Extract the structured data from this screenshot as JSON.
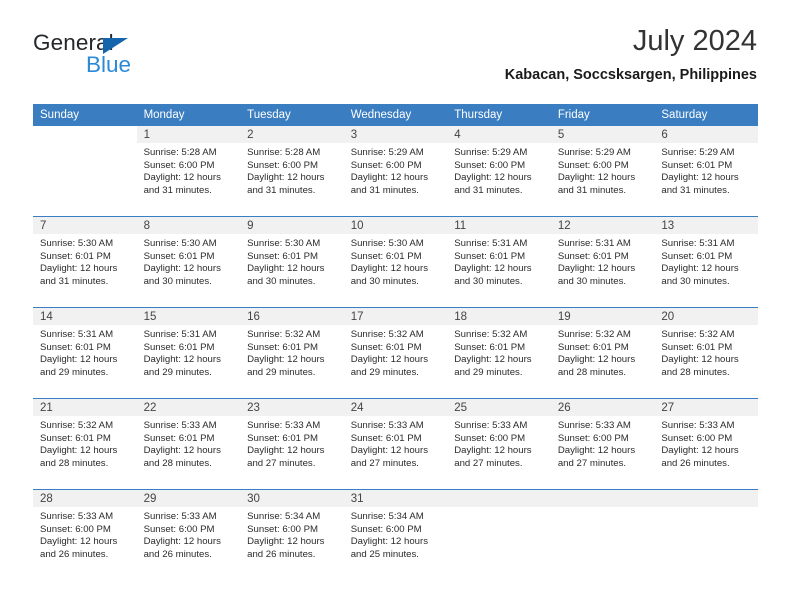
{
  "brand": {
    "name_part1": "General",
    "name_part2": "Blue",
    "accent_color": "#2b8ad8",
    "triangle_color": "#1565ad"
  },
  "header": {
    "title": "July 2024",
    "location": "Kabacan, Soccsksargen, Philippines"
  },
  "calendar": {
    "header_background": "#3a7dc0",
    "weekday_headers": [
      "Sunday",
      "Monday",
      "Tuesday",
      "Wednesday",
      "Thursday",
      "Friday",
      "Saturday"
    ],
    "weeks": [
      [
        {
          "day": "",
          "sunrise": "",
          "sunset": "",
          "daylight_line1": "",
          "daylight_line2": "",
          "blank": true
        },
        {
          "day": "1",
          "sunrise": "Sunrise: 5:28 AM",
          "sunset": "Sunset: 6:00 PM",
          "daylight_line1": "Daylight: 12 hours",
          "daylight_line2": "and 31 minutes."
        },
        {
          "day": "2",
          "sunrise": "Sunrise: 5:28 AM",
          "sunset": "Sunset: 6:00 PM",
          "daylight_line1": "Daylight: 12 hours",
          "daylight_line2": "and 31 minutes."
        },
        {
          "day": "3",
          "sunrise": "Sunrise: 5:29 AM",
          "sunset": "Sunset: 6:00 PM",
          "daylight_line1": "Daylight: 12 hours",
          "daylight_line2": "and 31 minutes."
        },
        {
          "day": "4",
          "sunrise": "Sunrise: 5:29 AM",
          "sunset": "Sunset: 6:00 PM",
          "daylight_line1": "Daylight: 12 hours",
          "daylight_line2": "and 31 minutes."
        },
        {
          "day": "5",
          "sunrise": "Sunrise: 5:29 AM",
          "sunset": "Sunset: 6:00 PM",
          "daylight_line1": "Daylight: 12 hours",
          "daylight_line2": "and 31 minutes."
        },
        {
          "day": "6",
          "sunrise": "Sunrise: 5:29 AM",
          "sunset": "Sunset: 6:01 PM",
          "daylight_line1": "Daylight: 12 hours",
          "daylight_line2": "and 31 minutes."
        }
      ],
      [
        {
          "day": "7",
          "sunrise": "Sunrise: 5:30 AM",
          "sunset": "Sunset: 6:01 PM",
          "daylight_line1": "Daylight: 12 hours",
          "daylight_line2": "and 31 minutes."
        },
        {
          "day": "8",
          "sunrise": "Sunrise: 5:30 AM",
          "sunset": "Sunset: 6:01 PM",
          "daylight_line1": "Daylight: 12 hours",
          "daylight_line2": "and 30 minutes."
        },
        {
          "day": "9",
          "sunrise": "Sunrise: 5:30 AM",
          "sunset": "Sunset: 6:01 PM",
          "daylight_line1": "Daylight: 12 hours",
          "daylight_line2": "and 30 minutes."
        },
        {
          "day": "10",
          "sunrise": "Sunrise: 5:30 AM",
          "sunset": "Sunset: 6:01 PM",
          "daylight_line1": "Daylight: 12 hours",
          "daylight_line2": "and 30 minutes."
        },
        {
          "day": "11",
          "sunrise": "Sunrise: 5:31 AM",
          "sunset": "Sunset: 6:01 PM",
          "daylight_line1": "Daylight: 12 hours",
          "daylight_line2": "and 30 minutes."
        },
        {
          "day": "12",
          "sunrise": "Sunrise: 5:31 AM",
          "sunset": "Sunset: 6:01 PM",
          "daylight_line1": "Daylight: 12 hours",
          "daylight_line2": "and 30 minutes."
        },
        {
          "day": "13",
          "sunrise": "Sunrise: 5:31 AM",
          "sunset": "Sunset: 6:01 PM",
          "daylight_line1": "Daylight: 12 hours",
          "daylight_line2": "and 30 minutes."
        }
      ],
      [
        {
          "day": "14",
          "sunrise": "Sunrise: 5:31 AM",
          "sunset": "Sunset: 6:01 PM",
          "daylight_line1": "Daylight: 12 hours",
          "daylight_line2": "and 29 minutes."
        },
        {
          "day": "15",
          "sunrise": "Sunrise: 5:31 AM",
          "sunset": "Sunset: 6:01 PM",
          "daylight_line1": "Daylight: 12 hours",
          "daylight_line2": "and 29 minutes."
        },
        {
          "day": "16",
          "sunrise": "Sunrise: 5:32 AM",
          "sunset": "Sunset: 6:01 PM",
          "daylight_line1": "Daylight: 12 hours",
          "daylight_line2": "and 29 minutes."
        },
        {
          "day": "17",
          "sunrise": "Sunrise: 5:32 AM",
          "sunset": "Sunset: 6:01 PM",
          "daylight_line1": "Daylight: 12 hours",
          "daylight_line2": "and 29 minutes."
        },
        {
          "day": "18",
          "sunrise": "Sunrise: 5:32 AM",
          "sunset": "Sunset: 6:01 PM",
          "daylight_line1": "Daylight: 12 hours",
          "daylight_line2": "and 29 minutes."
        },
        {
          "day": "19",
          "sunrise": "Sunrise: 5:32 AM",
          "sunset": "Sunset: 6:01 PM",
          "daylight_line1": "Daylight: 12 hours",
          "daylight_line2": "and 28 minutes."
        },
        {
          "day": "20",
          "sunrise": "Sunrise: 5:32 AM",
          "sunset": "Sunset: 6:01 PM",
          "daylight_line1": "Daylight: 12 hours",
          "daylight_line2": "and 28 minutes."
        }
      ],
      [
        {
          "day": "21",
          "sunrise": "Sunrise: 5:32 AM",
          "sunset": "Sunset: 6:01 PM",
          "daylight_line1": "Daylight: 12 hours",
          "daylight_line2": "and 28 minutes."
        },
        {
          "day": "22",
          "sunrise": "Sunrise: 5:33 AM",
          "sunset": "Sunset: 6:01 PM",
          "daylight_line1": "Daylight: 12 hours",
          "daylight_line2": "and 28 minutes."
        },
        {
          "day": "23",
          "sunrise": "Sunrise: 5:33 AM",
          "sunset": "Sunset: 6:01 PM",
          "daylight_line1": "Daylight: 12 hours",
          "daylight_line2": "and 27 minutes."
        },
        {
          "day": "24",
          "sunrise": "Sunrise: 5:33 AM",
          "sunset": "Sunset: 6:01 PM",
          "daylight_line1": "Daylight: 12 hours",
          "daylight_line2": "and 27 minutes."
        },
        {
          "day": "25",
          "sunrise": "Sunrise: 5:33 AM",
          "sunset": "Sunset: 6:00 PM",
          "daylight_line1": "Daylight: 12 hours",
          "daylight_line2": "and 27 minutes."
        },
        {
          "day": "26",
          "sunrise": "Sunrise: 5:33 AM",
          "sunset": "Sunset: 6:00 PM",
          "daylight_line1": "Daylight: 12 hours",
          "daylight_line2": "and 27 minutes."
        },
        {
          "day": "27",
          "sunrise": "Sunrise: 5:33 AM",
          "sunset": "Sunset: 6:00 PM",
          "daylight_line1": "Daylight: 12 hours",
          "daylight_line2": "and 26 minutes."
        }
      ],
      [
        {
          "day": "28",
          "sunrise": "Sunrise: 5:33 AM",
          "sunset": "Sunset: 6:00 PM",
          "daylight_line1": "Daylight: 12 hours",
          "daylight_line2": "and 26 minutes."
        },
        {
          "day": "29",
          "sunrise": "Sunrise: 5:33 AM",
          "sunset": "Sunset: 6:00 PM",
          "daylight_line1": "Daylight: 12 hours",
          "daylight_line2": "and 26 minutes."
        },
        {
          "day": "30",
          "sunrise": "Sunrise: 5:34 AM",
          "sunset": "Sunset: 6:00 PM",
          "daylight_line1": "Daylight: 12 hours",
          "daylight_line2": "and 26 minutes."
        },
        {
          "day": "31",
          "sunrise": "Sunrise: 5:34 AM",
          "sunset": "Sunset: 6:00 PM",
          "daylight_line1": "Daylight: 12 hours",
          "daylight_line2": "and 25 minutes."
        },
        {
          "day": "",
          "sunrise": "",
          "sunset": "",
          "daylight_line1": "",
          "daylight_line2": "",
          "empty": true
        },
        {
          "day": "",
          "sunrise": "",
          "sunset": "",
          "daylight_line1": "",
          "daylight_line2": "",
          "empty": true
        },
        {
          "day": "",
          "sunrise": "",
          "sunset": "",
          "daylight_line1": "",
          "daylight_line2": "",
          "empty": true
        }
      ]
    ]
  }
}
